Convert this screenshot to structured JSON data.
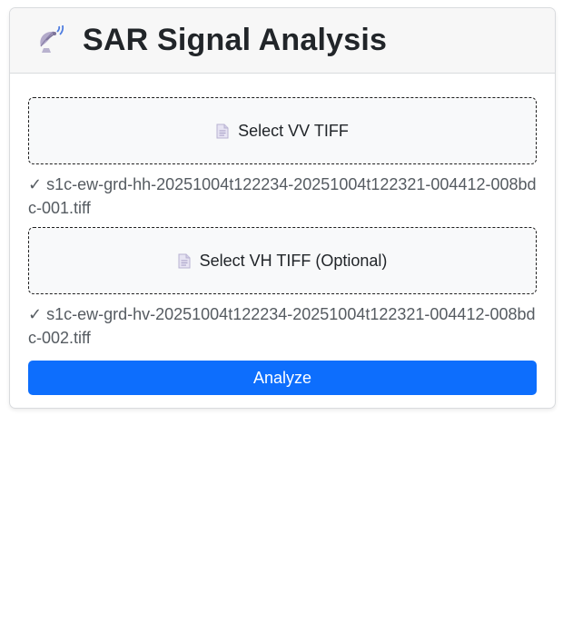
{
  "header": {
    "title": "SAR Signal Analysis",
    "icon": "satellite-dish-icon"
  },
  "vv_select": {
    "label": "Select VV TIFF",
    "icon": "document-icon",
    "selected_file": "✓ s1c-ew-grd-hh-20251004t122234-20251004t122321-004412-008bdc-001.tiff"
  },
  "vh_select": {
    "label": "Select VH TIFF (Optional)",
    "icon": "document-icon",
    "selected_file": "✓ s1c-ew-grd-hv-20251004t122234-20251004t122321-004412-008bdc-002.tiff"
  },
  "actions": {
    "analyze_label": "Analyze"
  },
  "colors": {
    "accent": "#0d6efd",
    "header_bg": "#f7f7f7",
    "drop_bg": "#f8f9fa"
  }
}
